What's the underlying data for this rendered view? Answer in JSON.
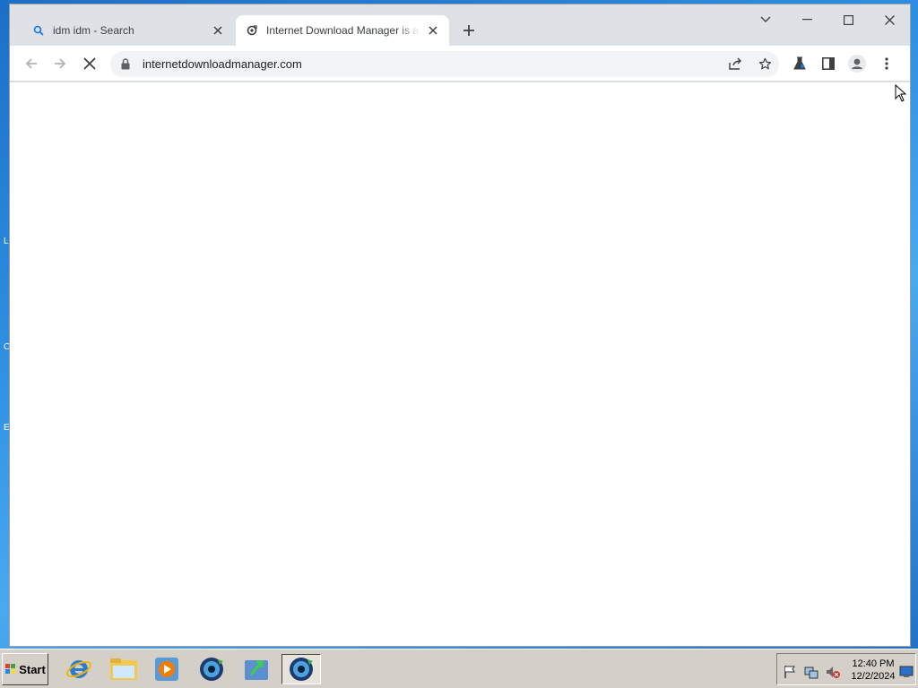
{
  "desktop": {
    "edge_chars": [
      "L",
      "C",
      "E"
    ]
  },
  "browser": {
    "tabs": [
      {
        "title": "idm idm - Search",
        "icon": "search-icon",
        "active": false
      },
      {
        "title": "Internet Download Manager is a powerful download accelerator",
        "icon": "idm-favicon",
        "active": true
      }
    ],
    "omnibox": {
      "url": "internetdownloadmanager.com"
    },
    "accent": "#1a73e8"
  },
  "taskbar": {
    "start_label": "Start",
    "apps": [
      "internet-explorer-icon",
      "file-explorer-icon",
      "media-player-icon",
      "idm-globe-icon",
      "download-arrow-icon",
      "idm-globe-active-icon"
    ],
    "clock": {
      "time": "12:40 PM",
      "date": "12/2/2024"
    }
  }
}
